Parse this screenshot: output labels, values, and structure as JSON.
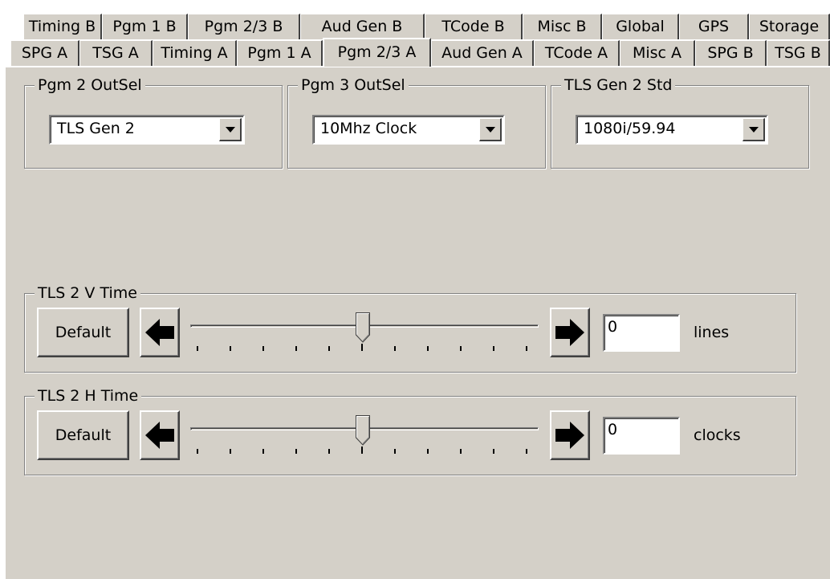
{
  "tabs": {
    "back_row": [
      "Timing B",
      "Pgm 1 B",
      "Pgm 2/3 B",
      "Aud Gen B",
      "TCode B",
      "Misc B",
      "Global",
      "GPS",
      "Storage"
    ],
    "front_row": [
      "SPG A",
      "TSG A",
      "Timing A",
      "Pgm 1 A",
      "Pgm 2/3 A",
      "Aud Gen A",
      "TCode A",
      "Misc A",
      "SPG B",
      "TSG B"
    ],
    "selected": "Pgm 2/3 A"
  },
  "pgm2_outsel": {
    "label": "Pgm 2 OutSel",
    "value": "TLS Gen 2"
  },
  "pgm3_outsel": {
    "label": "Pgm 3 OutSel",
    "value": "10Mhz Clock"
  },
  "tls_gen2_std": {
    "label": "TLS Gen 2 Std",
    "value": "1080i/59.94"
  },
  "tls2_v_time": {
    "label": "TLS 2 V Time",
    "default_label": "Default",
    "value": "0",
    "unit": "lines",
    "slider_position": 0.5
  },
  "tls2_h_time": {
    "label": "TLS 2 H Time",
    "default_label": "Default",
    "value": "0",
    "unit": "clocks",
    "slider_position": 0.5
  },
  "icons": {
    "dropdown": "chevron-down-icon",
    "decrement": "arrow-left-icon",
    "increment": "arrow-right-icon"
  }
}
